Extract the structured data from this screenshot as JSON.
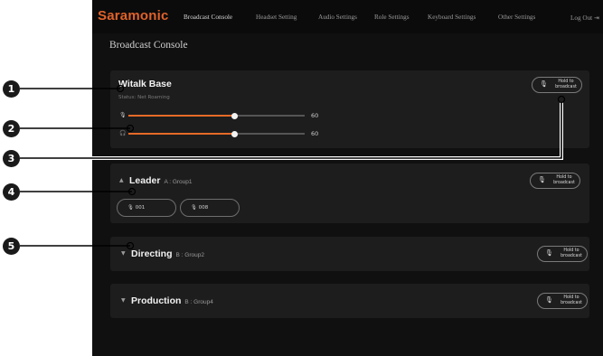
{
  "app": {
    "logo": "Saramonic",
    "nav": [
      "Broadcast Console",
      "Headset Setting",
      "Audio Settings",
      "Role Settings",
      "Keyboard Settings",
      "Other Settings"
    ],
    "active_nav": "Broadcast Console",
    "logout": "Log Out"
  },
  "page_title": "Broadcast Console",
  "base_card": {
    "title": "Witalk Base",
    "status": "Status: Net Roaming",
    "sliders": [
      {
        "icon": "mic-icon",
        "glyph": "🎙",
        "value": "60",
        "level": 0.6
      },
      {
        "icon": "headphones-icon",
        "glyph": "🎧",
        "value": "60",
        "level": 0.6
      }
    ],
    "hold_label": "Hold to broadcast"
  },
  "groups": [
    {
      "name": "Leader",
      "group": "A : Group1",
      "expanded": true,
      "members": [
        "001",
        "008"
      ],
      "hold_label": "Hold to broadcast"
    },
    {
      "name": "Directing",
      "group": "B : Group2",
      "expanded": false,
      "members": [],
      "hold_label": "Hold to broadcast"
    },
    {
      "name": "Production",
      "group": "B : Group4",
      "expanded": false,
      "members": [],
      "hold_label": "Hold to broadcast"
    }
  ],
  "callouts": [
    "1",
    "2",
    "3",
    "4",
    "5"
  ],
  "colors": {
    "accent": "#e56a28",
    "background": "#101010",
    "card": "#1d1d1d"
  }
}
